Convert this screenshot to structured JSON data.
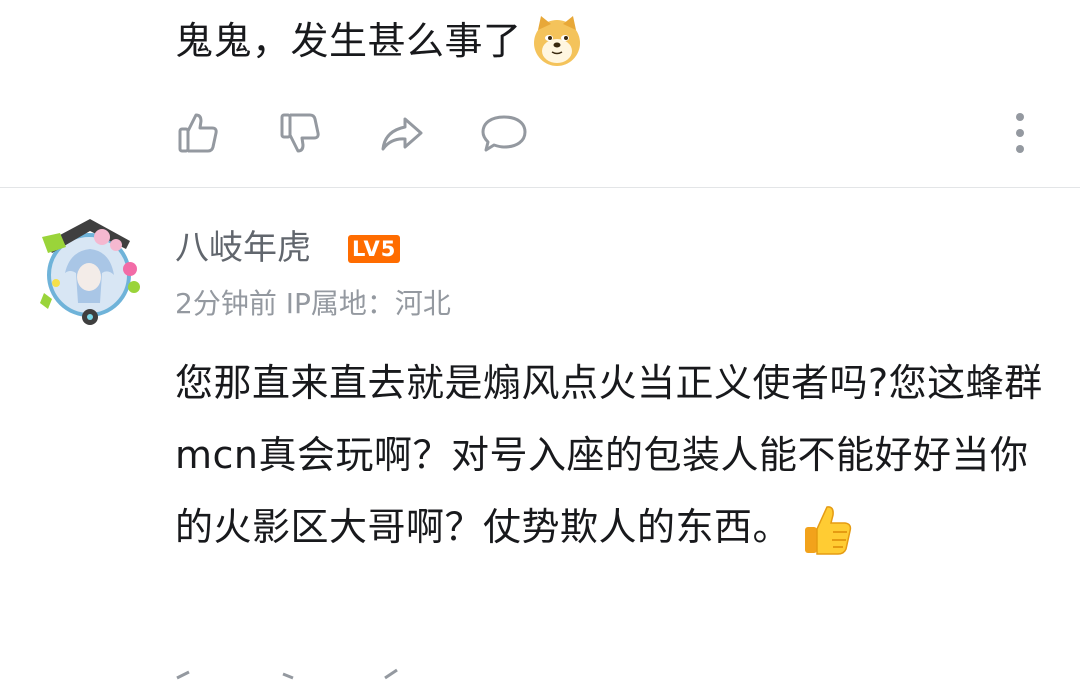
{
  "comment_prev": {
    "text": "鬼鬼，发生甚么事了",
    "emoji": "doge-emoji"
  },
  "actions": {
    "like": "thumbs-up-icon",
    "dislike": "thumbs-down-icon",
    "share": "share-icon",
    "reply": "reply-bubble-icon",
    "more": "more-vertical-icon"
  },
  "comment": {
    "username": "八岐年虎",
    "level": "LV5",
    "time": "2分钟前",
    "ip_location": "IP属地：河北",
    "text": "您那直来直去就是煽风点火当正义使者吗?您这蜂群mcn真会玩啊？对号入座的包装人能不能好好当你的火影区大哥啊？仗势欺人的东西。",
    "emoji": "thumbs-up-emoji"
  },
  "colors": {
    "text": "#18191c",
    "secondary": "#61666d",
    "meta": "#9499a0",
    "level": "#ff6c00",
    "divider": "#e3e5e7"
  }
}
